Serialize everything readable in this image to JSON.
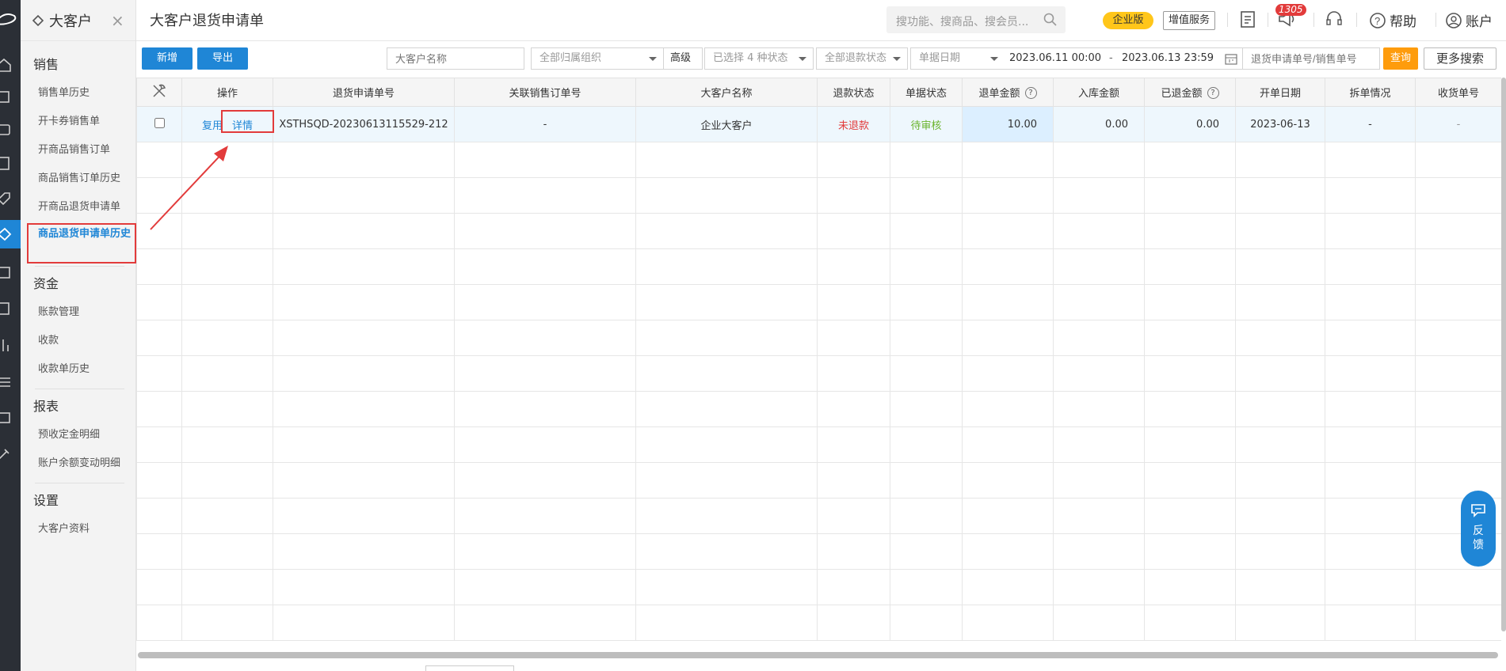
{
  "sidebar": {
    "title": "大客户",
    "close": "×",
    "groups": [
      {
        "label": "销售",
        "items": [
          "销售单历史",
          "开卡券销售单",
          "开商品销售订单",
          "商品销售订单历史",
          "开商品退货申请单",
          "商品退货申请单历史"
        ]
      },
      {
        "label": "资金",
        "items": [
          "账款管理",
          "收款",
          "收款单历史"
        ]
      },
      {
        "label": "报表",
        "items": [
          "预收定金明细",
          "账户余额变动明细"
        ]
      },
      {
        "label": "设置",
        "items": [
          "大客户资料"
        ]
      }
    ],
    "active_item": "商品退货申请单历史"
  },
  "header": {
    "page_title": "大客户退货申请单",
    "search_placeholder": "搜功能、搜商品、搜会员...",
    "edition_badge": "企业版",
    "vas_button": "增值服务",
    "notification_count": "1305",
    "help": "帮助",
    "account": "账户"
  },
  "toolbar": {
    "add": "新增",
    "export": "导出",
    "customer_name_placeholder": "大客户名称",
    "org_select": "全部归属组织",
    "advanced": "高级",
    "status_select": "已选择 4 种状态",
    "refund_select": "全部退款状态",
    "date_type": "单据日期",
    "date_from": "2023.06.11 00:00",
    "date_sep": "-",
    "date_to": "2023.06.13 23:59",
    "order_no_placeholder": "退货申请单号/销售单号",
    "query": "查询",
    "more_search": "更多搜索"
  },
  "table": {
    "headers": {
      "op": "操作",
      "return_no": "退货申请单号",
      "related_order": "关联销售订单号",
      "customer": "大客户名称",
      "refund_status": "退款状态",
      "doc_status": "单据状态",
      "return_amount": "退单金额",
      "stock_amount": "入库金额",
      "refunded_amount": "已退金额",
      "open_date": "开单日期",
      "split": "拆单情况",
      "receipt_no": "收货单号"
    },
    "row": {
      "reuse": "复用",
      "detail": "详情",
      "return_no": "XSTHSQD-20230613115529-212",
      "related_order": "-",
      "customer": "企业大客户",
      "refund_status": "未退款",
      "doc_status": "待审核",
      "return_amount": "10.00",
      "stock_amount": "0.00",
      "refunded_amount": "0.00",
      "open_date": "2023-06-13",
      "split": "-",
      "receipt_no": "-"
    }
  },
  "feedback": "反馈",
  "colors": {
    "accent": "#1f86d6",
    "query": "#fe9c0c",
    "badge": "#ffc61a",
    "danger": "#e23b3b",
    "success": "#6ab42c",
    "rail": "#2b2f36"
  }
}
